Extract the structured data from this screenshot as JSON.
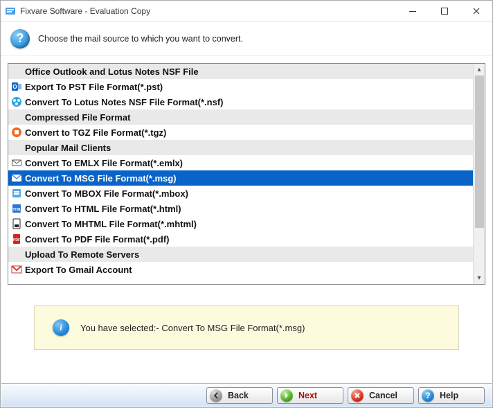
{
  "window": {
    "title": "Fixvare Software - Evaluation Copy"
  },
  "header": {
    "prompt": "Choose the mail source to which you want to convert."
  },
  "list": {
    "rows": [
      {
        "kind": "header",
        "label": "Office Outlook and Lotus Notes NSF File"
      },
      {
        "kind": "item",
        "icon": "outlook",
        "label": "Export To PST File Format(*.pst)"
      },
      {
        "kind": "item",
        "icon": "nsf",
        "label": "Convert To Lotus Notes NSF File Format(*.nsf)"
      },
      {
        "kind": "header",
        "label": "Compressed File Format"
      },
      {
        "kind": "item",
        "icon": "tgz",
        "label": "Convert to TGZ File Format(*.tgz)"
      },
      {
        "kind": "header",
        "label": "Popular Mail Clients"
      },
      {
        "kind": "item",
        "icon": "emlx",
        "label": "Convert To EMLX File Format(*.emlx)"
      },
      {
        "kind": "item",
        "icon": "msg",
        "label": "Convert To MSG File Format(*.msg)",
        "selected": true
      },
      {
        "kind": "item",
        "icon": "mbox",
        "label": "Convert To MBOX File Format(*.mbox)"
      },
      {
        "kind": "item",
        "icon": "html",
        "label": "Convert To HTML File Format(*.html)"
      },
      {
        "kind": "item",
        "icon": "mhtml",
        "label": "Convert To MHTML File Format(*.mhtml)"
      },
      {
        "kind": "item",
        "icon": "pdf",
        "label": "Convert To PDF File Format(*.pdf)"
      },
      {
        "kind": "header",
        "label": "Upload To Remote Servers"
      },
      {
        "kind": "item",
        "icon": "gmail",
        "label": "Export To Gmail Account"
      }
    ]
  },
  "info": {
    "text": "You have selected:- Convert To MSG File Format(*.msg)"
  },
  "buttons": {
    "back": "Back",
    "next": "Next",
    "cancel": "Cancel",
    "help": "Help"
  }
}
